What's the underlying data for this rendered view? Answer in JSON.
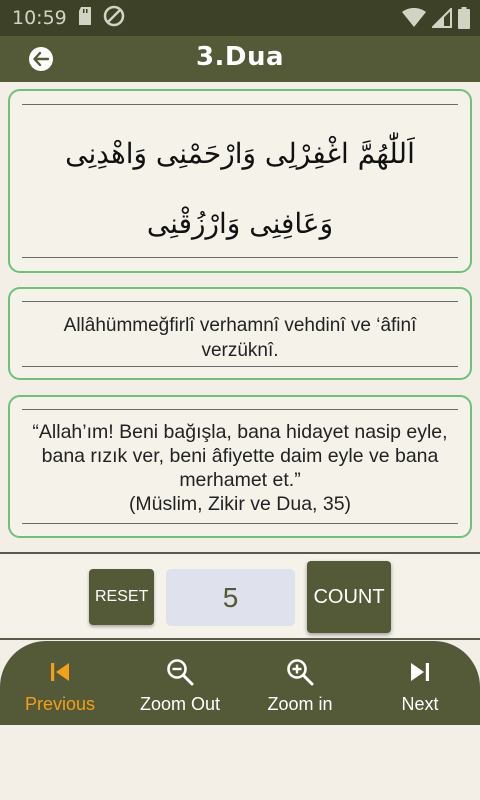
{
  "status_bar": {
    "time": "10:59"
  },
  "header": {
    "title": "3.Dua"
  },
  "dua": {
    "arabic": "اَللّٰهُمَّ اغْفِرْلِى وَارْحَمْنِى وَاهْدِنِى وَعَافِنِى وَارْزُقْنِى",
    "transliteration": "Allâhümmeğfirlî verhamnî vehdinî ve ‘âfinî verzüknî.",
    "meaning": "“Allah’ım! Beni bağışla, bana hidayet nasip eyle, bana rızık ver, beni âfiyette daim eyle ve bana merhamet et.”",
    "source": "(Müslim, Zikir ve Dua, 35)"
  },
  "counter": {
    "reset_label": "RESET",
    "value": "5",
    "count_label": "COUNT"
  },
  "bottom_nav": {
    "items": [
      {
        "label": "Previous",
        "icon": "skip-previous-icon"
      },
      {
        "label": "Zoom Out",
        "icon": "zoom-out-icon"
      },
      {
        "label": "Zoom in",
        "icon": "zoom-in-icon"
      },
      {
        "label": "Next",
        "icon": "skip-next-icon"
      }
    ],
    "active_color": "#f2a019"
  },
  "colors": {
    "primary": "#545a37",
    "status_bar": "#3d4128",
    "card_border": "#6ec07a",
    "background": "#f3efe6"
  }
}
